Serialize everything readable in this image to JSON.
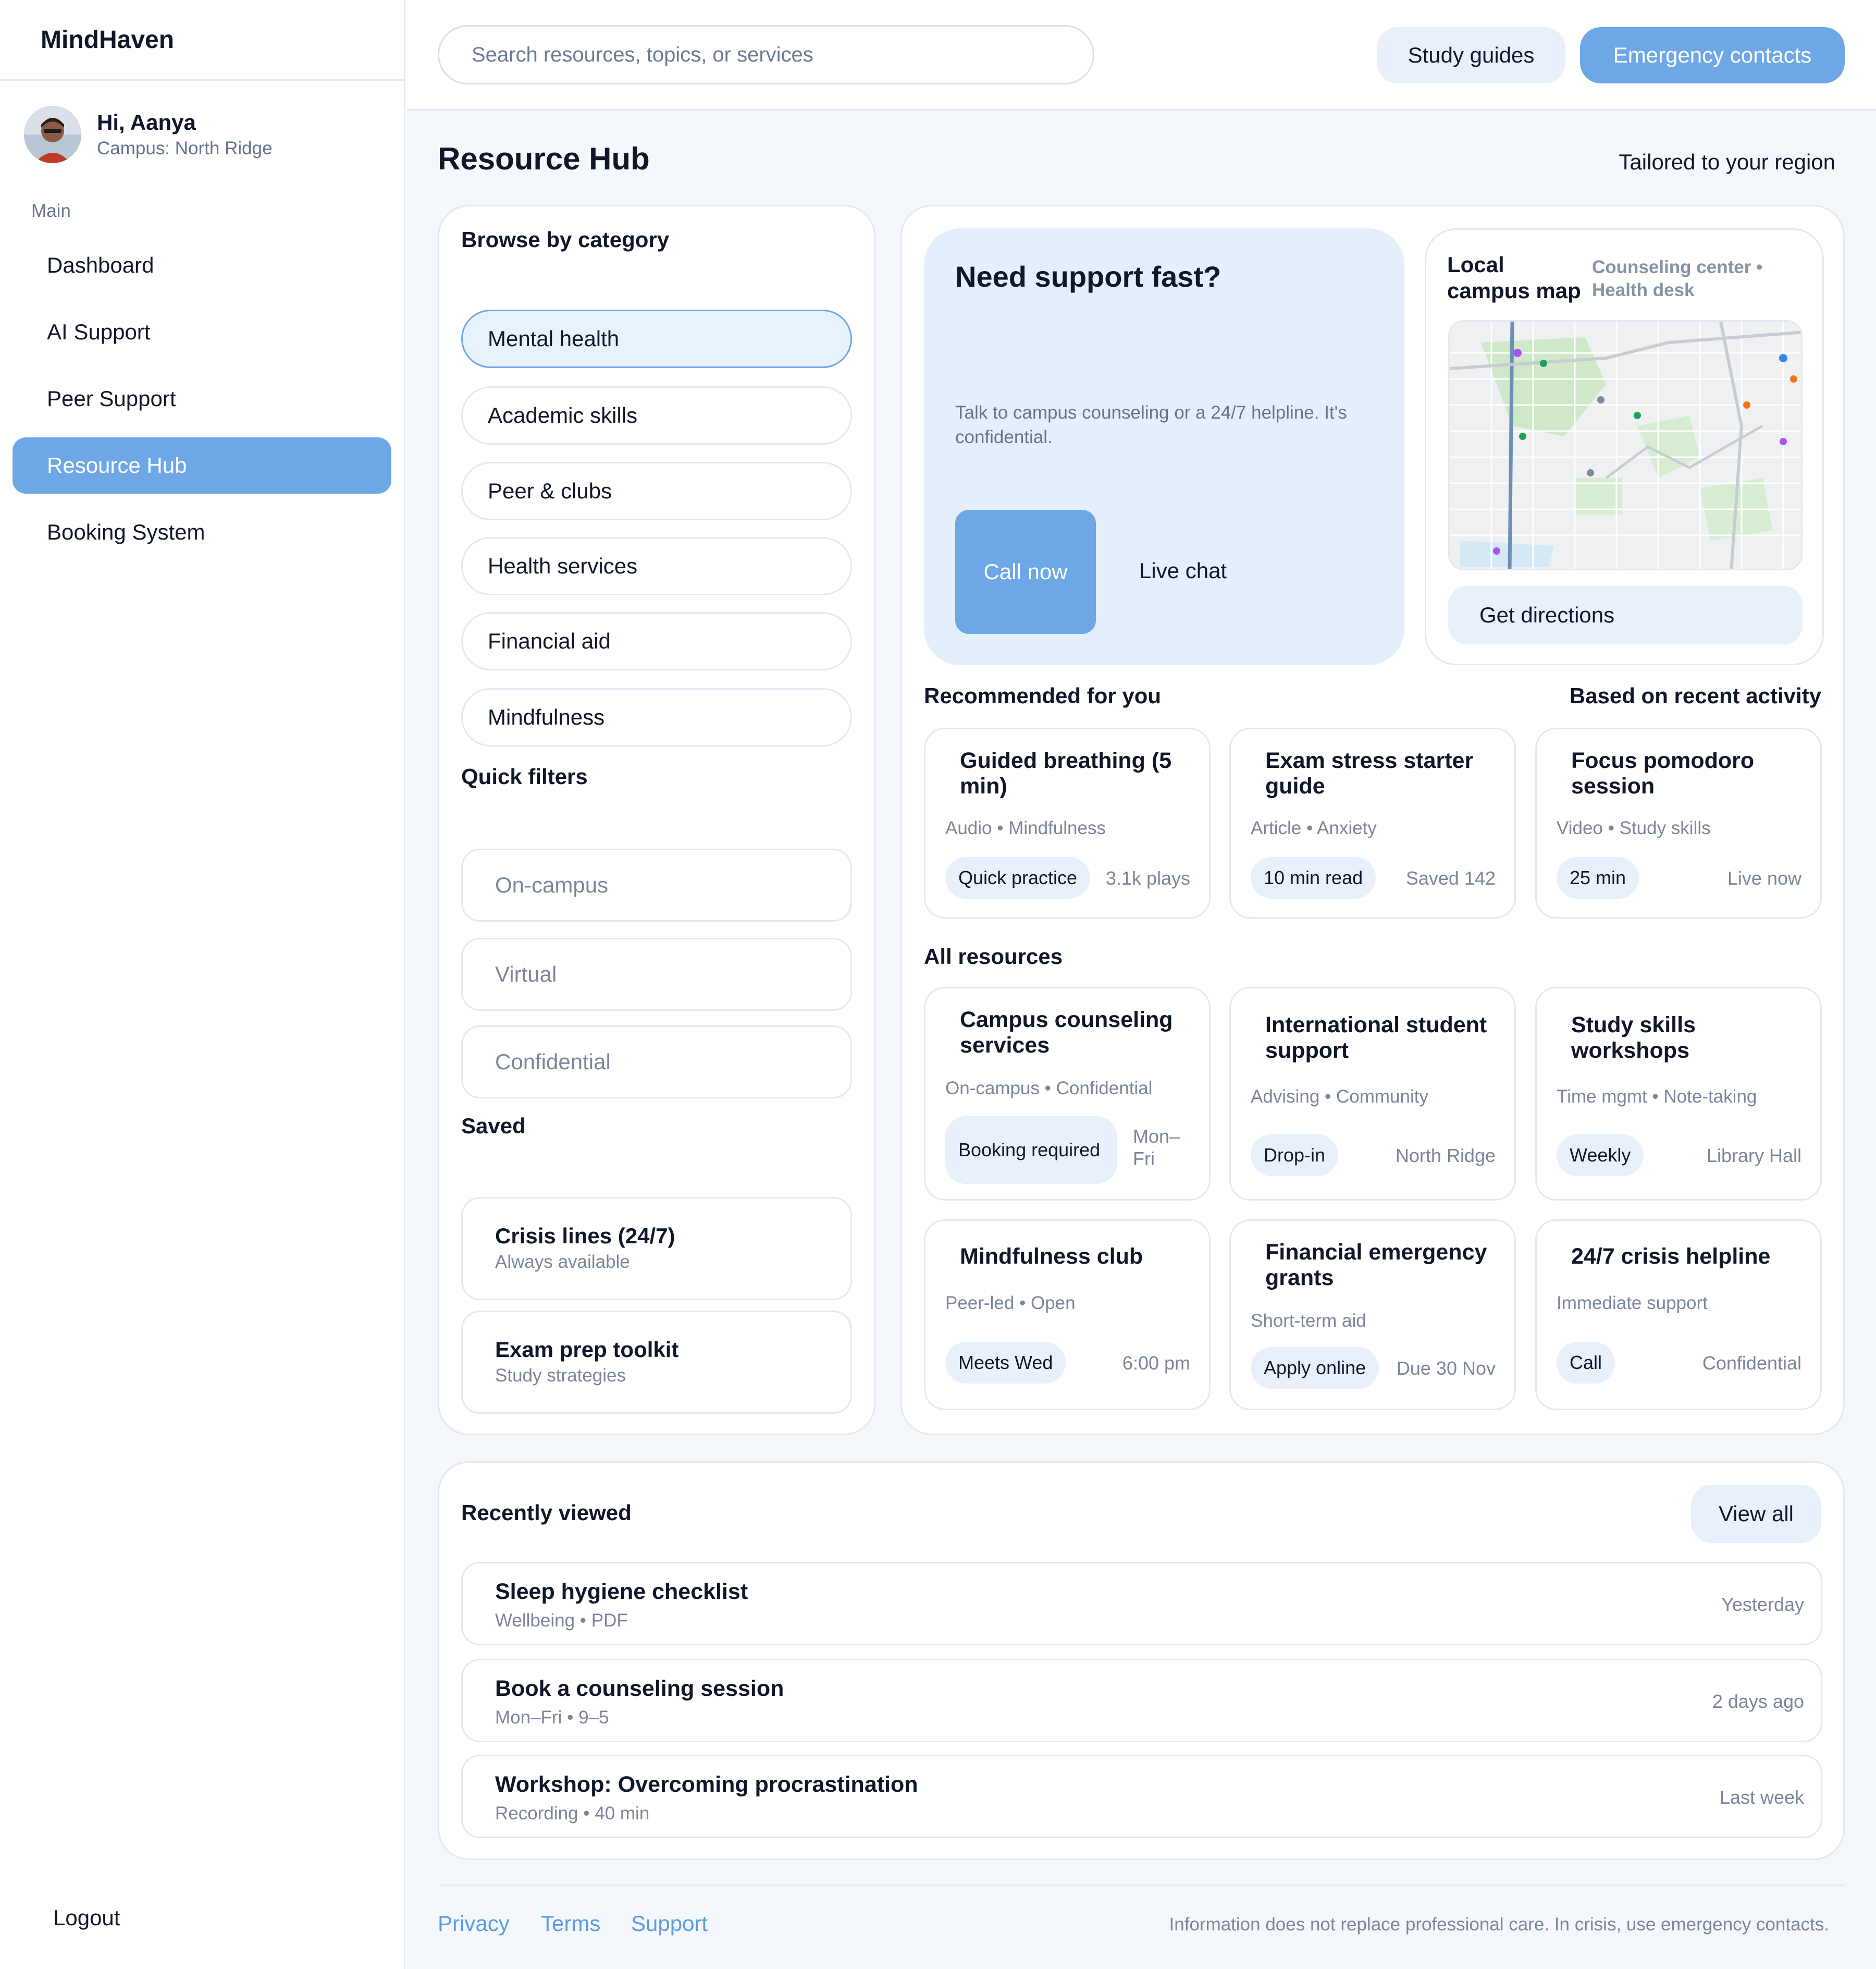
{
  "app": {
    "name": "MindHaven"
  },
  "user": {
    "greeting": "Hi, Aanya",
    "campus": "Campus: North Ridge"
  },
  "sidebar": {
    "section_label": "Main",
    "items": [
      {
        "label": "Dashboard"
      },
      {
        "label": "AI Support"
      },
      {
        "label": "Peer Support"
      },
      {
        "label": "Resource Hub",
        "active": true
      },
      {
        "label": "Booking System"
      }
    ],
    "logout": "Logout"
  },
  "topbar": {
    "search_placeholder": "Search resources, topics, or services",
    "study_guides": "Study guides",
    "emergency_contacts": "Emergency contacts"
  },
  "page": {
    "title": "Resource Hub",
    "subtitle": "Tailored to your region"
  },
  "browse": {
    "heading": "Browse by category",
    "categories": [
      "Mental health",
      "Academic skills",
      "Peer & clubs",
      "Health services",
      "Financial aid",
      "Mindfulness"
    ],
    "selected_category": "Mental health",
    "quick_filters_heading": "Quick filters",
    "filters": [
      "On-campus",
      "Virtual",
      "Confidential"
    ],
    "saved_heading": "Saved",
    "saved": [
      {
        "title": "Crisis lines (24/7)",
        "sub": "Always available"
      },
      {
        "title": "Exam prep toolkit",
        "sub": "Study strategies"
      }
    ]
  },
  "support": {
    "title": "Need support fast?",
    "desc": "Talk to campus counseling or a 24/7 helpline. It's confidential.",
    "call": "Call now",
    "chat": "Live chat"
  },
  "map": {
    "title": "Local campus map",
    "note": "Counseling center • Health desk",
    "directions": "Get directions"
  },
  "recommended": {
    "heading": "Recommended for you",
    "aside": "Based on recent activity",
    "cards": [
      {
        "title": "Guided breathing (5 min)",
        "meta": "Audio • Mindfulness",
        "tag": "Quick practice",
        "aside": "3.1k plays"
      },
      {
        "title": "Exam stress starter guide",
        "meta": "Article • Anxiety",
        "tag": "10 min read",
        "aside": "Saved 142"
      },
      {
        "title": "Focus pomodoro session",
        "meta": "Video • Study skills",
        "tag": "25 min",
        "aside": "Live now"
      }
    ]
  },
  "all_resources": {
    "heading": "All resources",
    "cards": [
      {
        "title": "Campus counseling services",
        "meta": "On-campus • Confidential",
        "tag": "Booking required",
        "aside": "Mon–Fri"
      },
      {
        "title": "International student support",
        "meta": "Advising • Community",
        "tag": "Drop-in",
        "aside": "North Ridge"
      },
      {
        "title": "Study skills workshops",
        "meta": "Time mgmt • Note-taking",
        "tag": "Weekly",
        "aside": "Library Hall"
      },
      {
        "title": "Mindfulness club",
        "meta": "Peer-led • Open",
        "tag": "Meets Wed",
        "aside": "6:00 pm"
      },
      {
        "title": "Financial emergency grants",
        "meta": "Short-term aid",
        "tag": "Apply online",
        "aside": "Due 30 Nov"
      },
      {
        "title": "24/7 crisis helpline",
        "meta": "Immediate support",
        "tag": "Call",
        "aside": "Confidential"
      }
    ]
  },
  "recent": {
    "heading": "Recently viewed",
    "view_all": "View all",
    "items": [
      {
        "title": "Sleep hygiene checklist",
        "sub": "Wellbeing • PDF",
        "time": "Yesterday"
      },
      {
        "title": "Book a counseling session",
        "sub": "Mon–Fri • 9–5",
        "time": "2 days ago"
      },
      {
        "title": "Workshop: Overcoming procrastination",
        "sub": "Recording • 40 min",
        "time": "Last week"
      }
    ]
  },
  "footer": {
    "links": [
      "Privacy",
      "Terms",
      "Support"
    ],
    "note": "Information does not replace professional care. In crisis, use emergency contacts."
  },
  "colors": {
    "accent": "#6ea7e6",
    "accent_soft": "#e8f1fb",
    "background": "#f4f8fd"
  }
}
